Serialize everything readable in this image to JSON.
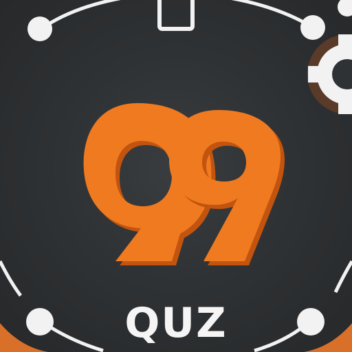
{
  "logo": {
    "mark": "Q9 monogram",
    "wordmark": "QUZ",
    "colors": {
      "background": "#2f3234",
      "mark": "#f07a1f",
      "mark_shadow": "#c2540f",
      "ring": "#f2f2f2",
      "border_accent": "#d8702a"
    }
  }
}
